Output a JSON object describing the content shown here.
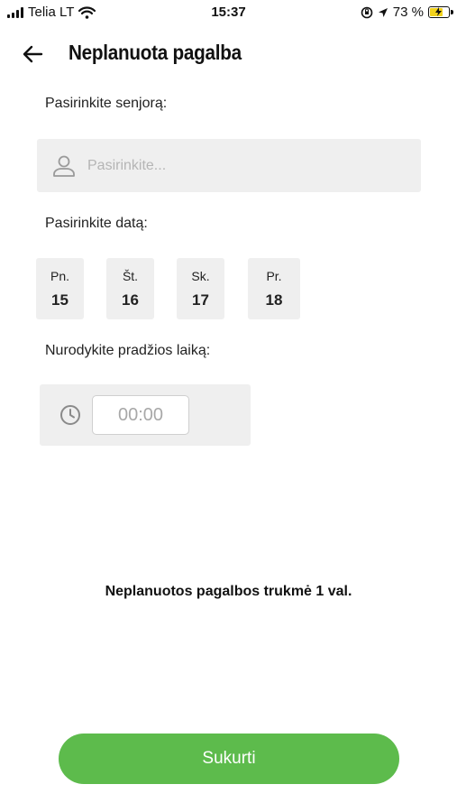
{
  "status_bar": {
    "carrier": "Telia LT",
    "time": "15:37",
    "battery_percent": "73 %",
    "battery_level": 0.73,
    "icons": [
      "signal-icon",
      "wifi-icon",
      "orientation-lock-icon",
      "location-arrow-icon",
      "battery-charging-icon"
    ]
  },
  "header": {
    "title": "Neplanuota pagalba",
    "back_icon": "arrow-left-icon"
  },
  "senior": {
    "label": "Pasirinkite senjorą:",
    "placeholder": "Pasirinkite...",
    "icon": "user-icon"
  },
  "date": {
    "label": "Pasirinkite datą:",
    "options": [
      {
        "weekday": "Pn.",
        "day": "15"
      },
      {
        "weekday": "Št.",
        "day": "16"
      },
      {
        "weekday": "Sk.",
        "day": "17"
      },
      {
        "weekday": "Pr.",
        "day": "18"
      }
    ]
  },
  "time": {
    "label": "Nurodykite pradžios laiką:",
    "placeholder": "00:00",
    "icon": "clock-icon"
  },
  "duration_note": "Neplanuotos pagalbos trukmė 1 val.",
  "actions": {
    "create_label": "Sukurti"
  },
  "colors": {
    "accent_green": "#5dbb4c",
    "field_background": "#efefef",
    "battery_yellow": "#f2d21b"
  }
}
